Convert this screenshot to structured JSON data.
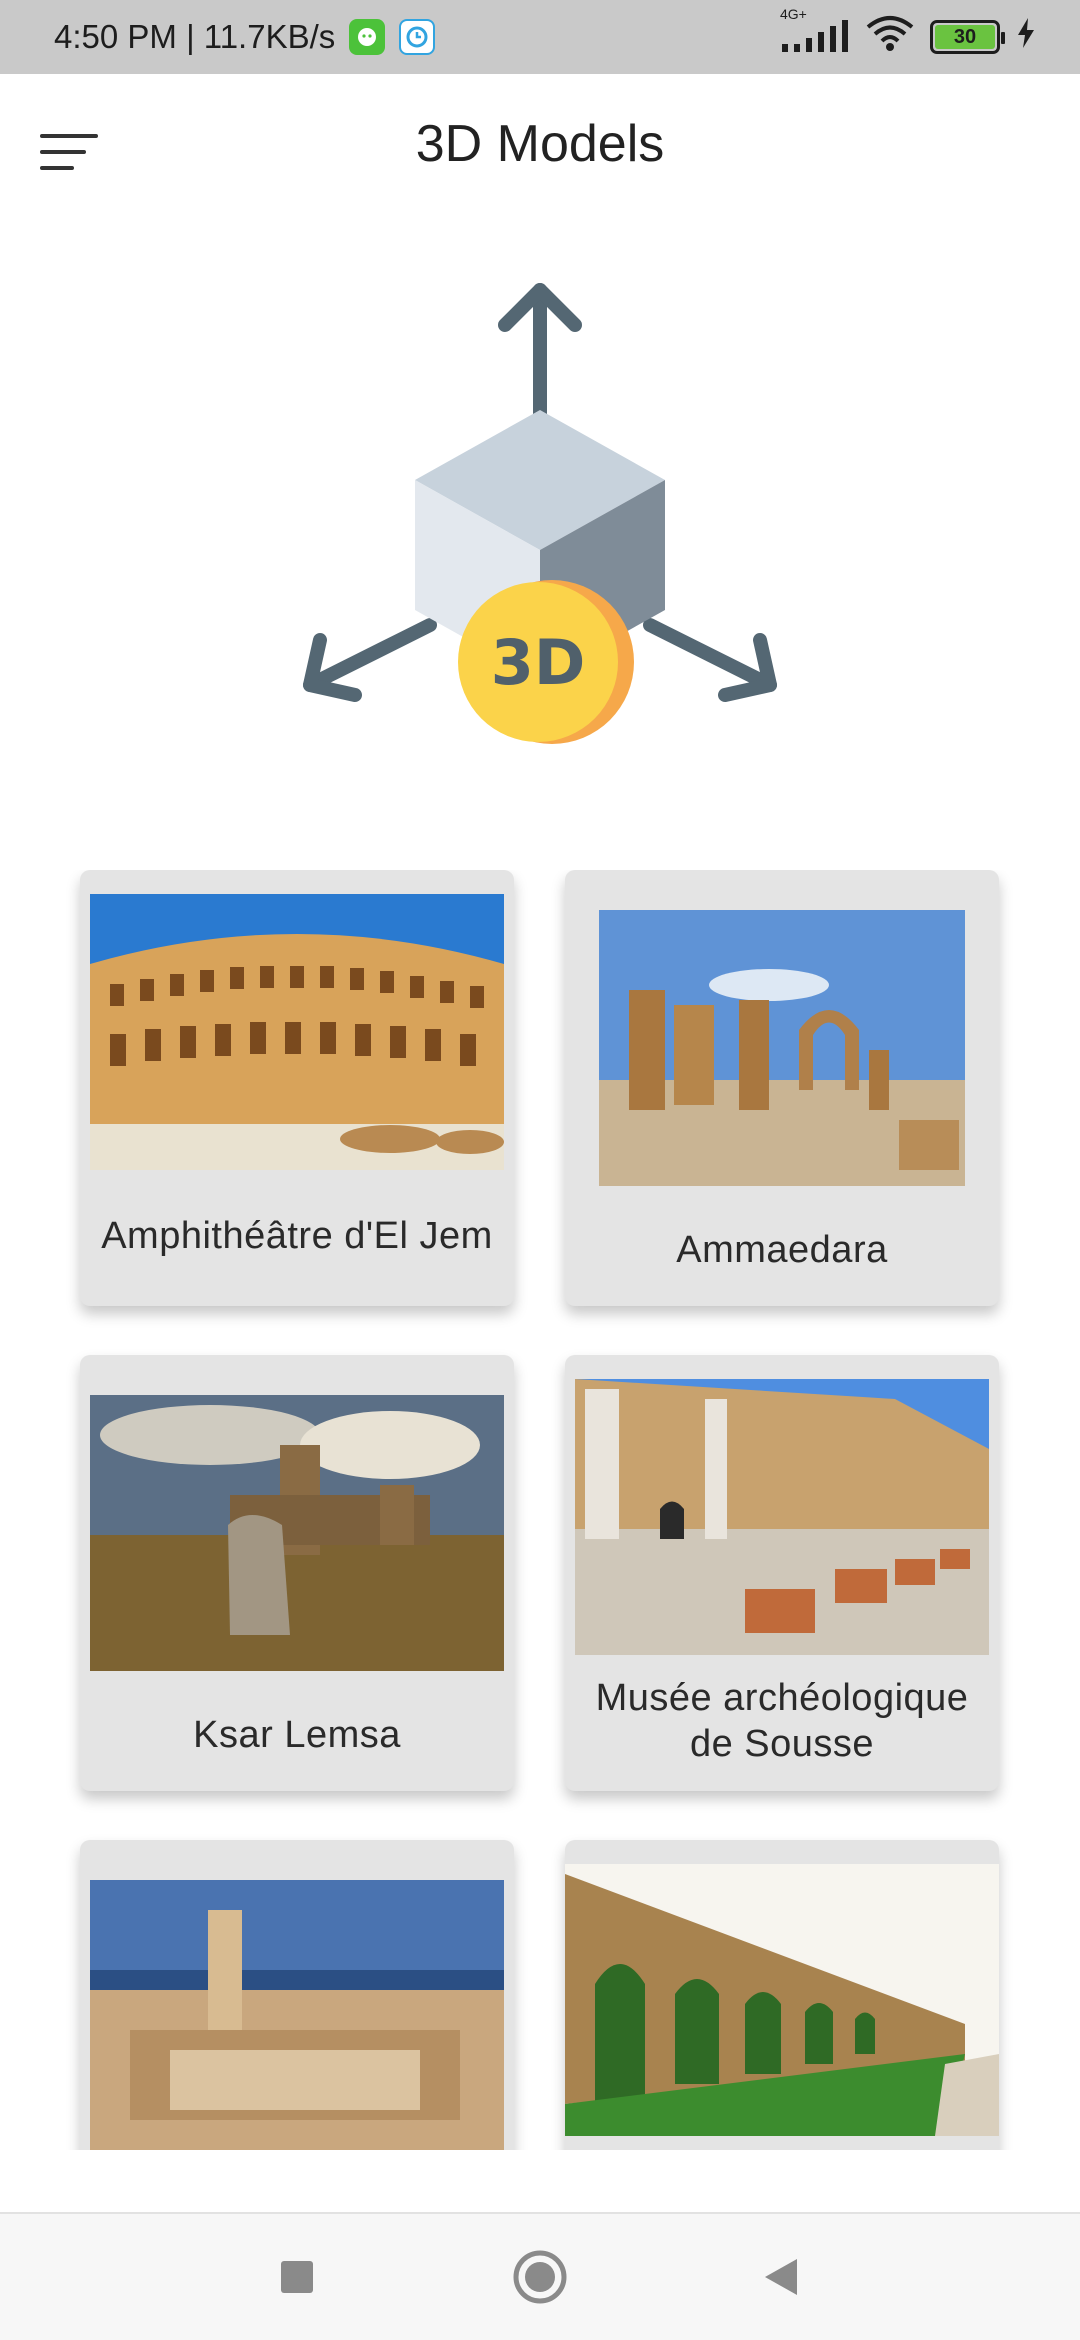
{
  "status_bar": {
    "time_speed": "4:50 PM | 11.7KB/s",
    "network": "4G+",
    "battery": "30"
  },
  "header": {
    "title": "3D Models",
    "menu_icon": "menu-icon"
  },
  "hero": {
    "badge_text": "3D"
  },
  "models": [
    {
      "name": "Amphithéâtre d'El Jem"
    },
    {
      "name": "Ammaedara"
    },
    {
      "name": "Ksar Lemsa"
    },
    {
      "name": "Musée archéologique de Sousse"
    },
    {
      "name": ""
    },
    {
      "name": ""
    }
  ],
  "colors": {
    "status_bar": "#c9c9c9",
    "card_bg": "#e4e4e4",
    "arrow": "#546773",
    "badge": "#fbd34a"
  }
}
